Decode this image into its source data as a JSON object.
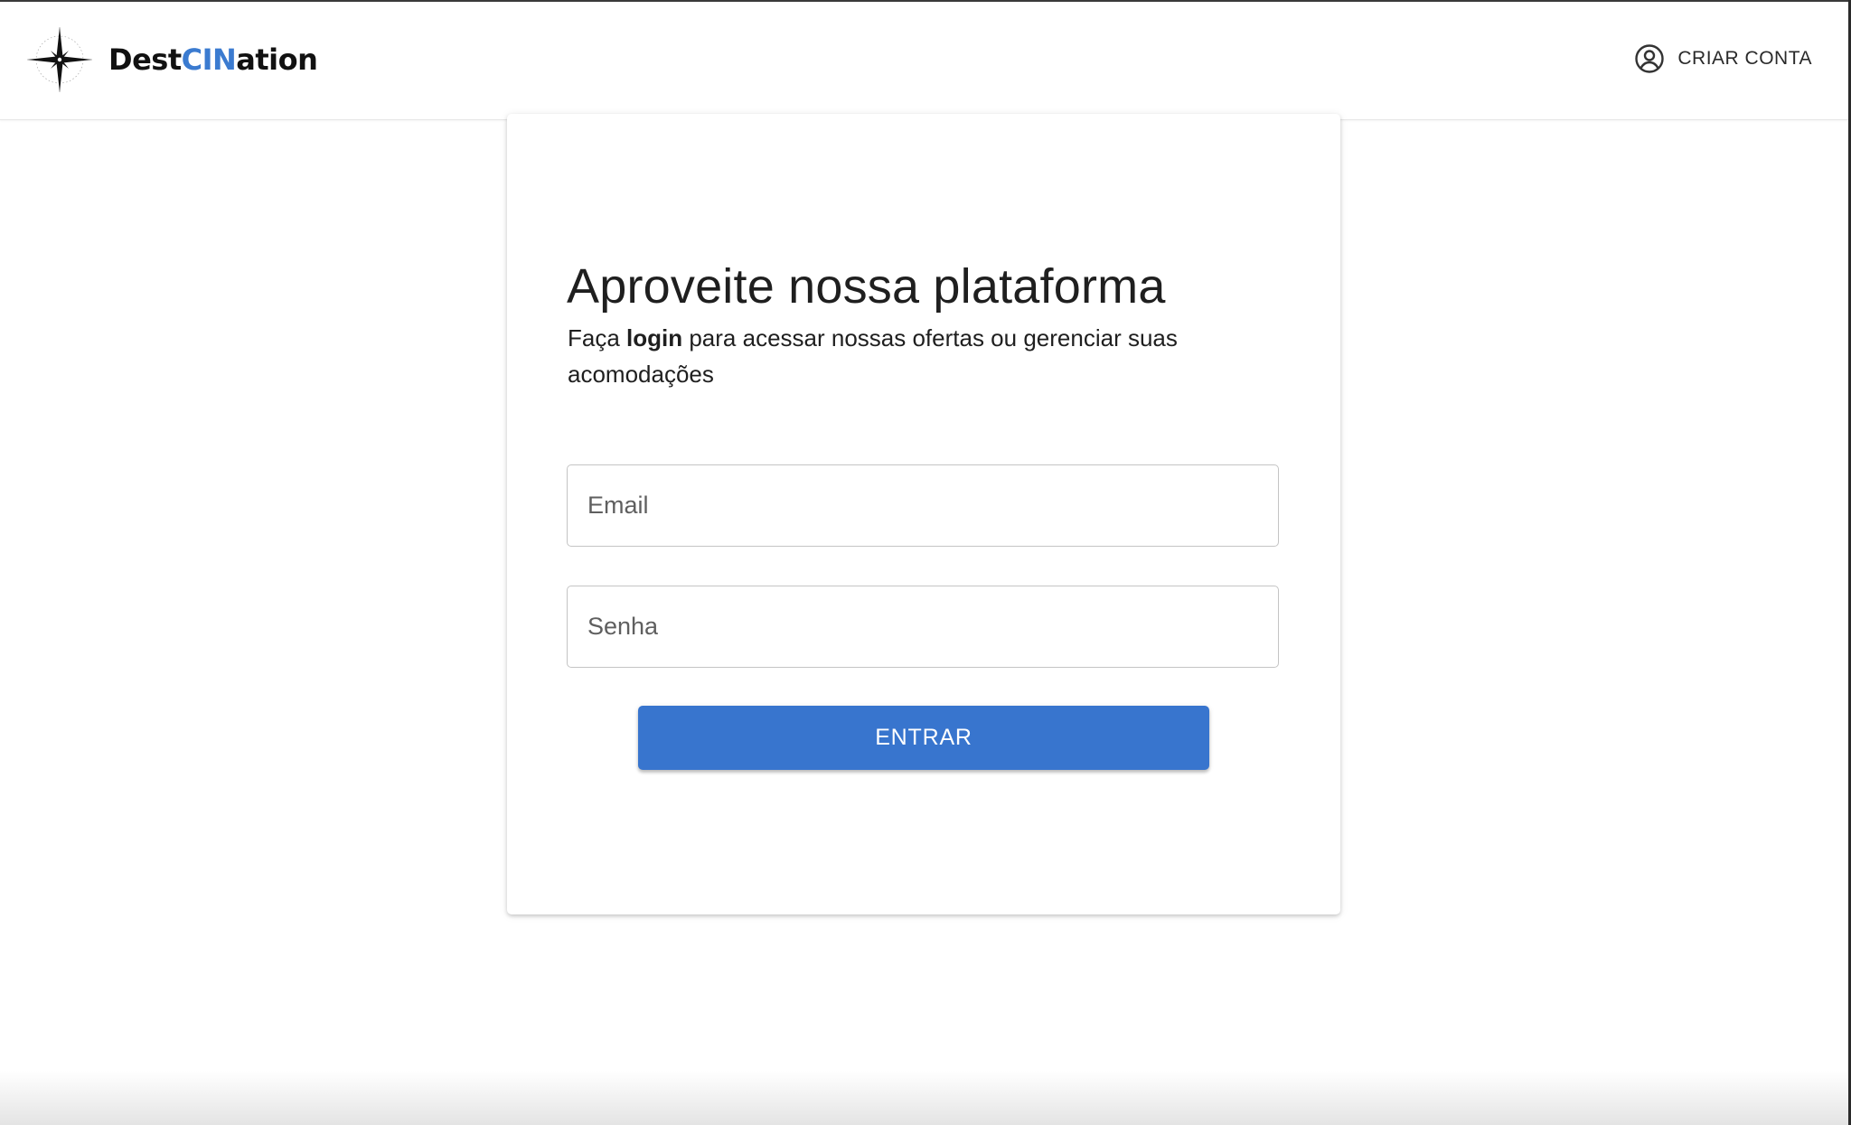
{
  "app": {
    "brand_prefix": "Dest",
    "brand_accent": "CIN",
    "brand_suffix": "ation",
    "logo_icon": "compass-star-icon",
    "accent_color": "#3b7bd0"
  },
  "header": {
    "create_account_label": "CRIAR CONTA",
    "create_account_icon": "user-circle-icon"
  },
  "login": {
    "title": "Aproveite nossa plataforma",
    "subtitle_before": "Faça ",
    "subtitle_bold": "login",
    "subtitle_after": " para acessar nossas ofertas ou gerenciar suas acomodações",
    "email_placeholder": "Email",
    "email_value": "",
    "password_placeholder": "Senha",
    "password_value": "",
    "submit_label": "ENTRAR",
    "button_color": "#3875ce"
  }
}
